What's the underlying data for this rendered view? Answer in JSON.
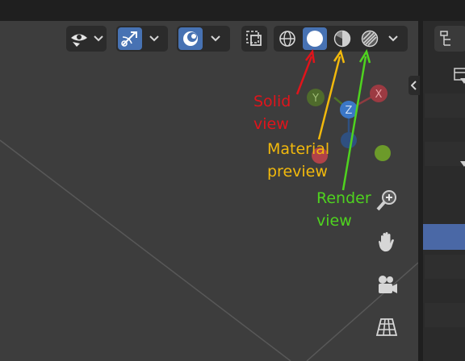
{
  "header": {
    "icons": [
      "visibility-icon",
      "gizmo-icon",
      "overlay-icon",
      "xray-icon",
      "wireframe-shading-icon",
      "solid-shading-icon",
      "material-shading-icon",
      "rendered-shading-icon"
    ]
  },
  "shading": {
    "active": "solid"
  },
  "gizmo": {
    "x": "X",
    "y": "Y",
    "z": "Z"
  },
  "annotations": {
    "solid": {
      "text": "Solid\nview",
      "color": "#e0141b"
    },
    "material": {
      "text": "Material\npreview",
      "color": "#f2b90c"
    },
    "render": {
      "text": "Render\nview",
      "color": "#4fd31f"
    }
  },
  "colors": {
    "accent": "#4772b3",
    "x_axis": "#c6434a",
    "y_axis": "#6c9a2a",
    "z_axis": "#3b77c6"
  }
}
